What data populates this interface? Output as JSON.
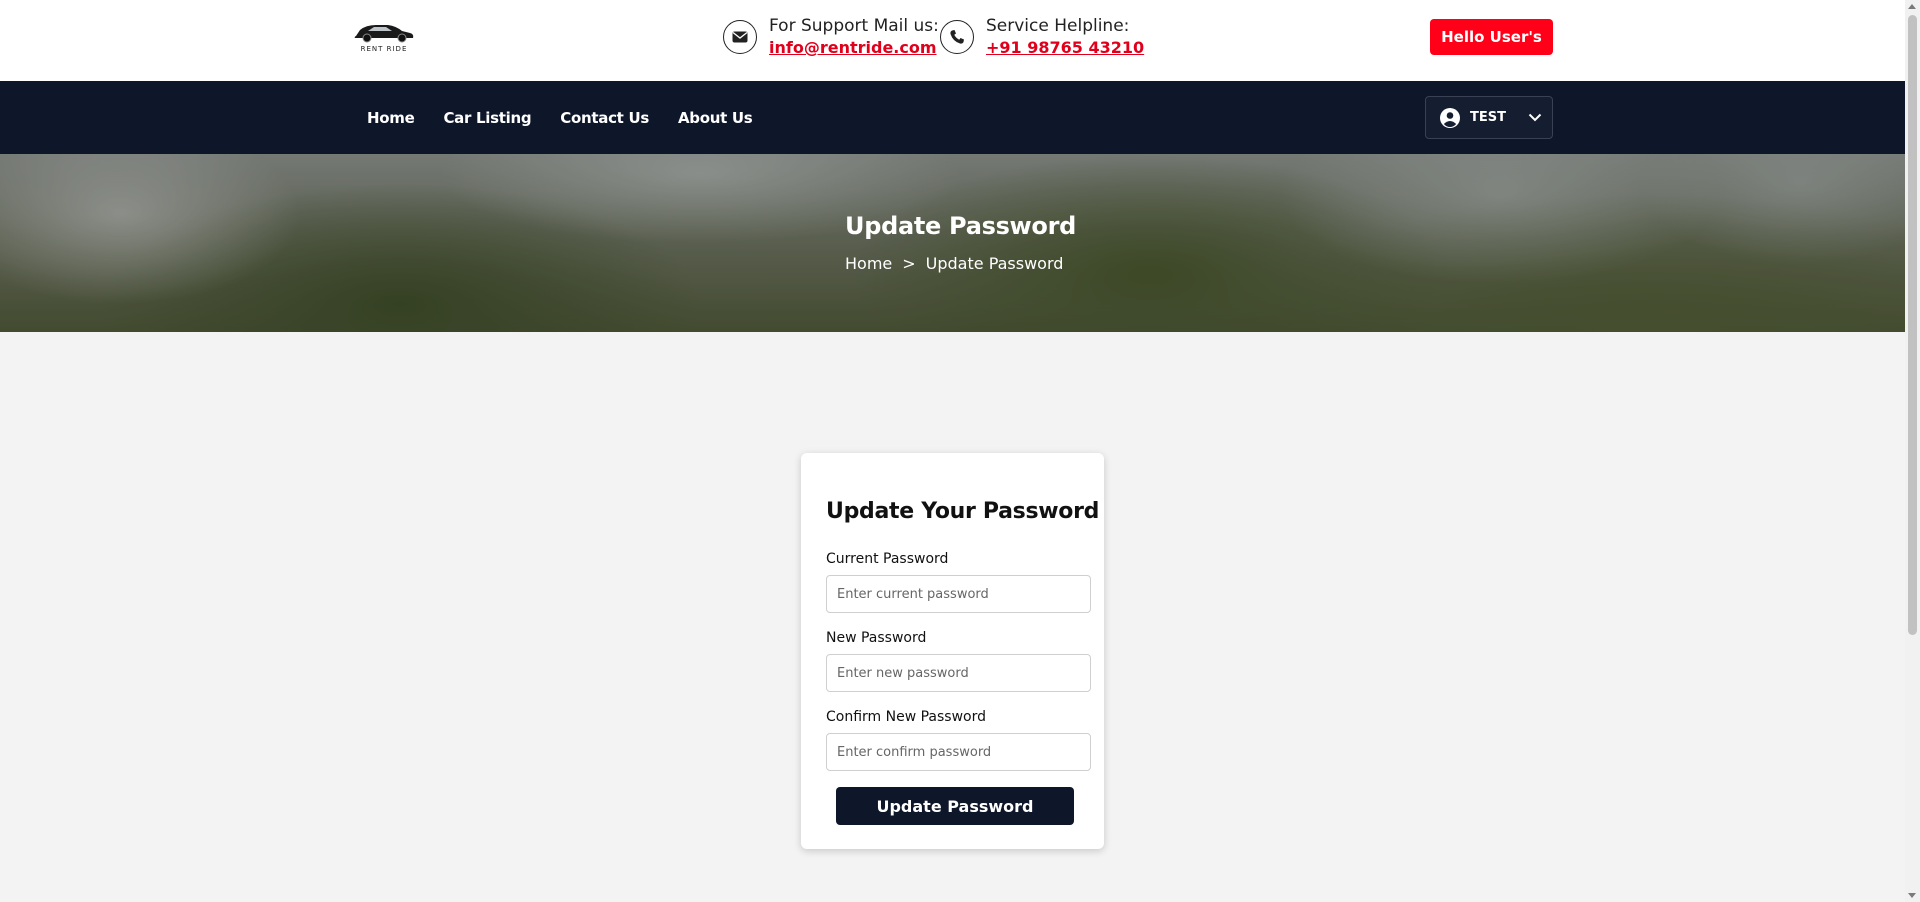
{
  "header": {
    "logo_text": "RENT RIDE",
    "support_label": "For Support Mail us:",
    "support_email": "info@rentride.com",
    "helpline_label": "Service Helpline:",
    "helpline_number": "+91 98765 43210",
    "hello_button": "Hello User's",
    "icons": [
      "car-logo-icon",
      "envelope-icon",
      "phone-icon"
    ]
  },
  "nav": {
    "items": [
      {
        "label": "Home"
      },
      {
        "label": "Car Listing"
      },
      {
        "label": "Contact Us"
      },
      {
        "label": "About Us"
      }
    ],
    "user": {
      "name": "TEST",
      "icons": [
        "user-circle-icon",
        "chevron-down-icon"
      ]
    }
  },
  "banner": {
    "title": "Update Password",
    "breadcrumb": {
      "home": "Home",
      "separator": ">",
      "current": "Update Password"
    }
  },
  "form": {
    "title": "Update Your Password",
    "fields": [
      {
        "label": "Current Password",
        "placeholder": "Enter current password",
        "value": ""
      },
      {
        "label": "New Password",
        "placeholder": "Enter new password",
        "value": ""
      },
      {
        "label": "Confirm New Password",
        "placeholder": "Enter confirm password",
        "value": ""
      }
    ],
    "submit_label": "Update Password"
  },
  "colors": {
    "accent_red": "#ff0018",
    "link_red": "#e0001b",
    "navy": "#0e162a",
    "page_bg": "#f3f3f3"
  }
}
